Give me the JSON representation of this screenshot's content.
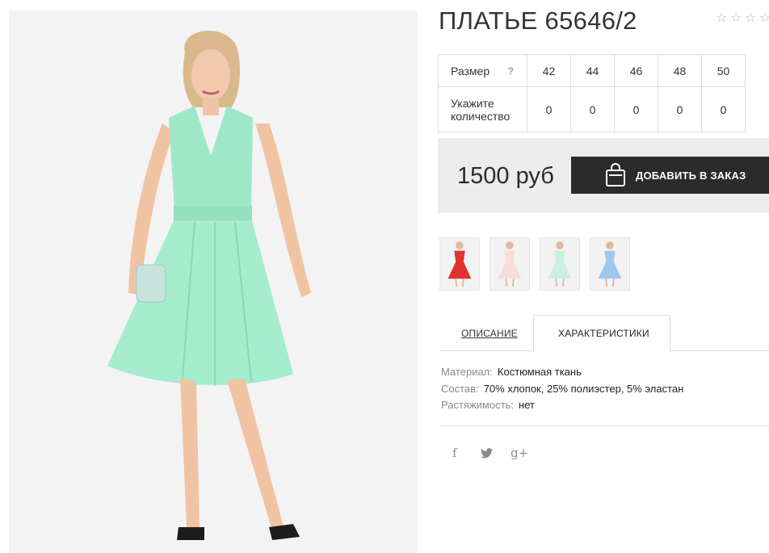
{
  "product": {
    "title": "ПЛАТЬЕ 65646/2",
    "rating_max": 5,
    "rating_value": 0
  },
  "sizes": {
    "label": "Размер",
    "help": "?",
    "values": [
      "42",
      "44",
      "46",
      "48",
      "50"
    ],
    "qty_label": "Укажите количество",
    "qty_label_line1": "Укажите",
    "qty_label_line2": "количество",
    "quantities": [
      "0",
      "0",
      "0",
      "0",
      "0"
    ]
  },
  "price": {
    "text": "1500 руб",
    "cart_button": "ДОБАВИТЬ В ЗАКАЗ"
  },
  "colors": {
    "variants": [
      "#e0332f",
      "#f6ddd8",
      "#c9f0e1",
      "#9fc8ef"
    ]
  },
  "tabs": {
    "description": "ОПИСАНИЕ",
    "characteristics": "ХАРАКТЕРИСТИКИ",
    "active": "characteristics"
  },
  "specs": [
    {
      "key": "Материал:",
      "value": "Костюмная ткань"
    },
    {
      "key": "Состав:",
      "value": "70% хлопок, 25% полиэстер, 5% эластан"
    },
    {
      "key": "Растяжимость:",
      "value": "нет"
    }
  ],
  "social": {
    "facebook": "f",
    "twitter": "🐦",
    "google": "g+"
  },
  "theme": {
    "dress_color": "#9ee8c9",
    "button_color": "#2b2b2b",
    "price_bg": "#ececec"
  }
}
